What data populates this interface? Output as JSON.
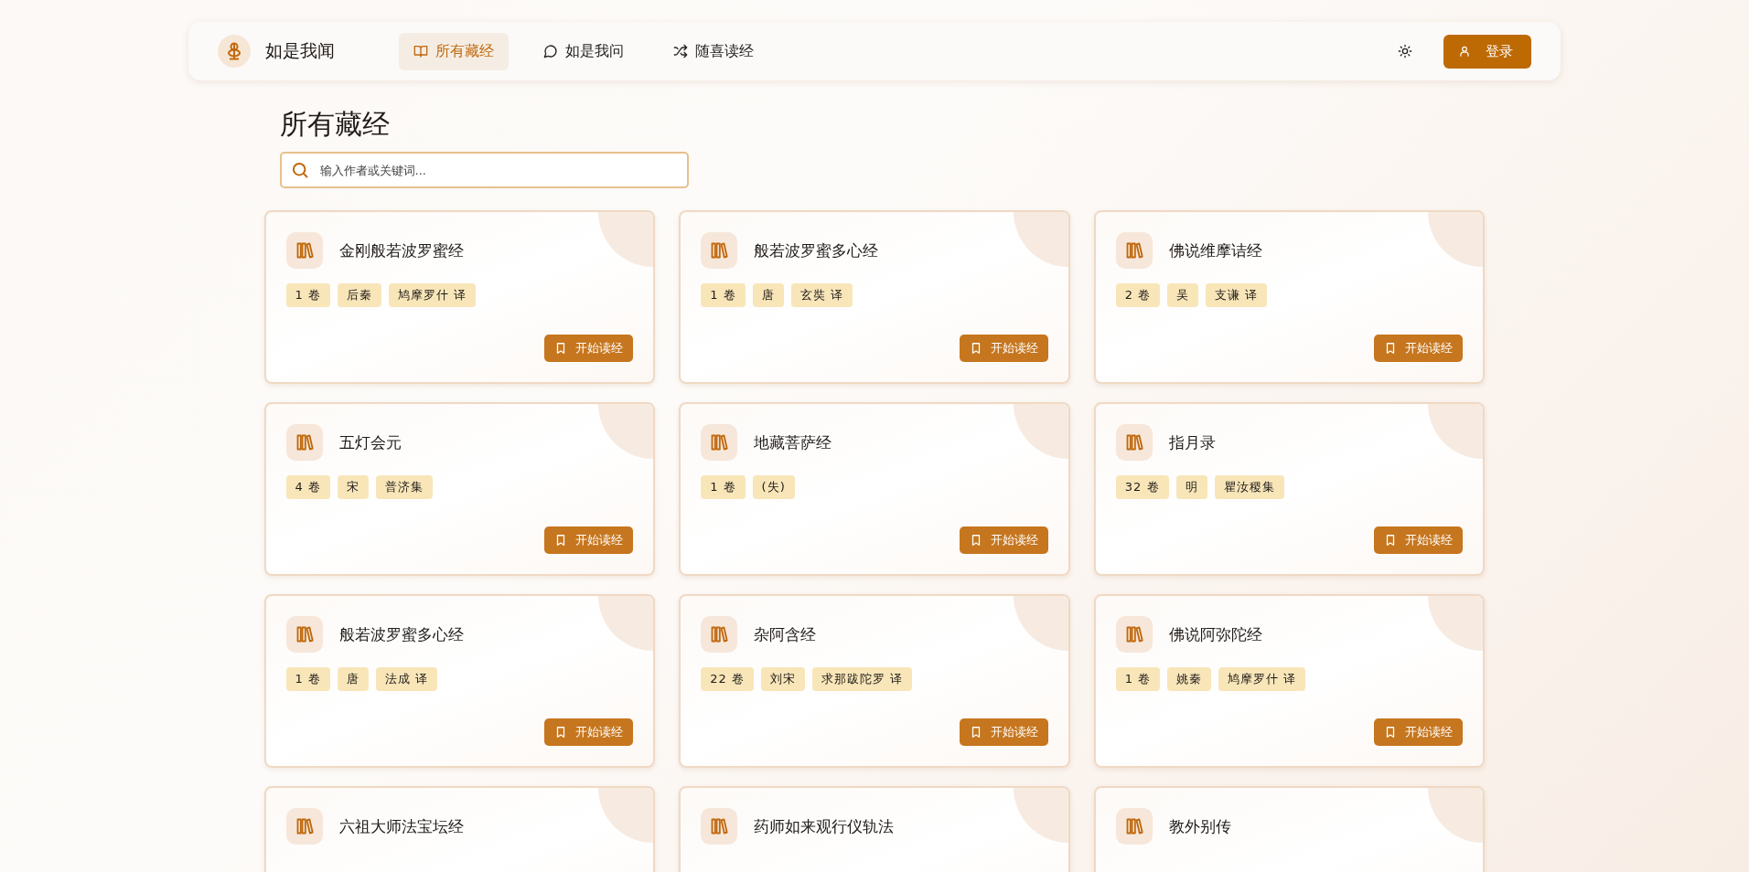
{
  "brand": {
    "name": "如是我闻"
  },
  "nav": [
    {
      "label": "所有藏经",
      "selected": true
    },
    {
      "label": "如是我问",
      "selected": false
    },
    {
      "label": "随喜读经",
      "selected": false
    }
  ],
  "login_button": "登录",
  "page_title": "所有藏经",
  "search": {
    "placeholder": "输入作者或关键词..."
  },
  "sutras": [
    {
      "title": "金刚般若波罗蜜经",
      "tags": [
        "1 卷",
        "后秦",
        "鸠摩罗什 译"
      ],
      "action": "开始读经"
    },
    {
      "title": "般若波罗蜜多心经",
      "tags": [
        "1 卷",
        "唐",
        "玄奘 译"
      ],
      "action": "开始读经"
    },
    {
      "title": "佛说维摩诘经",
      "tags": [
        "2 卷",
        "吴",
        "支谦 译"
      ],
      "action": "开始读经"
    },
    {
      "title": "五灯会元",
      "tags": [
        "4 卷",
        "宋",
        "普济集"
      ],
      "action": "开始读经"
    },
    {
      "title": "地藏菩萨经",
      "tags": [
        "1 卷",
        "(失)"
      ],
      "action": "开始读经"
    },
    {
      "title": "指月录",
      "tags": [
        "32 卷",
        "明",
        "瞿汝稷集"
      ],
      "action": "开始读经"
    },
    {
      "title": "般若波罗蜜多心经",
      "tags": [
        "1 卷",
        "唐",
        "法成 译"
      ],
      "action": "开始读经"
    },
    {
      "title": "杂阿含经",
      "tags": [
        "22 卷",
        "刘宋",
        "求那跋陀罗 译"
      ],
      "action": "开始读经"
    },
    {
      "title": "佛说阿弥陀经",
      "tags": [
        "1 卷",
        "姚秦",
        "鸠摩罗什 译"
      ],
      "action": "开始读经"
    },
    {
      "title": "六祖大师法宝坛经"
    },
    {
      "title": "药师如来观行仪轨法"
    },
    {
      "title": "教外别传"
    }
  ]
}
